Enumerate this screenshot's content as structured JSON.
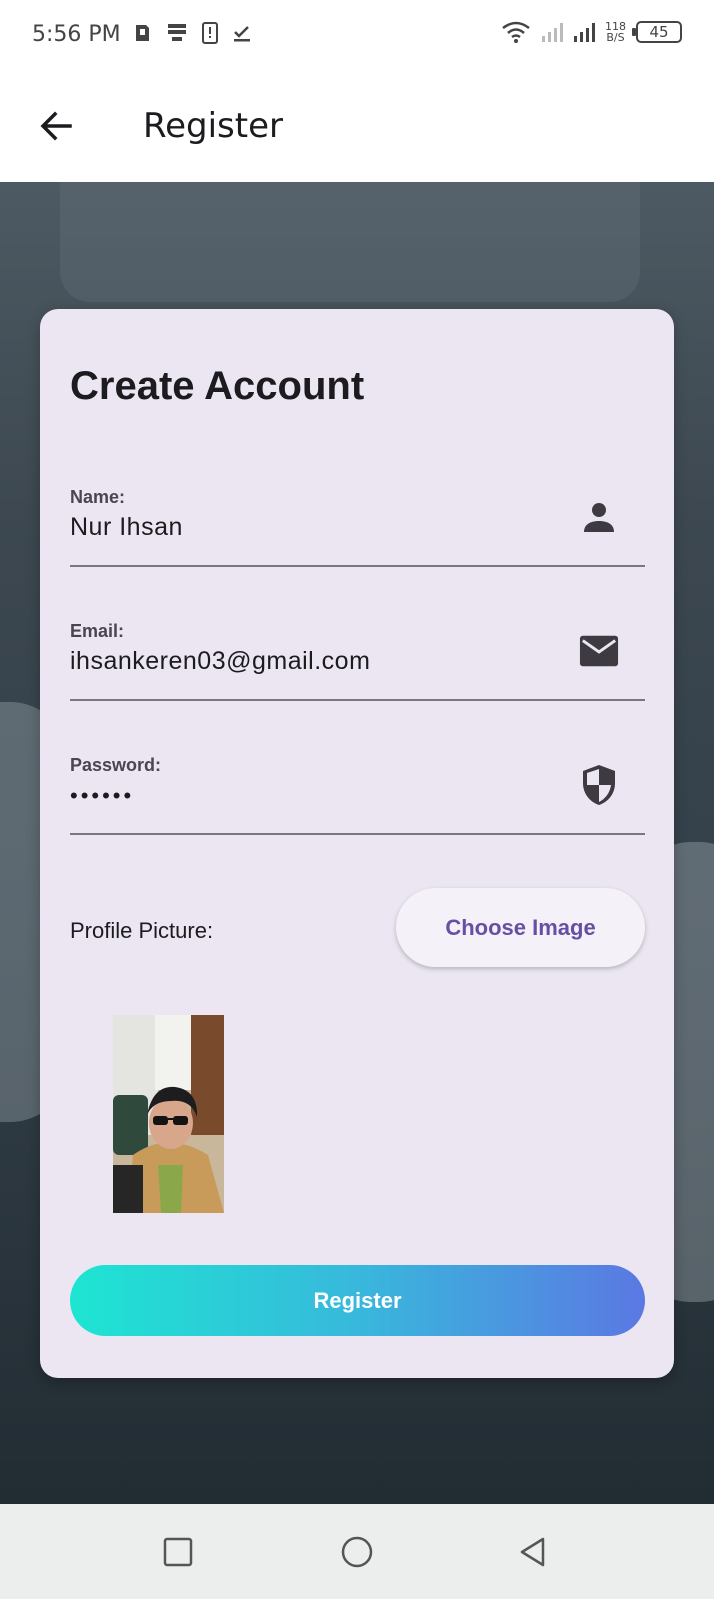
{
  "status_bar": {
    "time": "5:56 PM",
    "net_speed_value": "118",
    "net_speed_unit": "B/S",
    "battery": "45"
  },
  "app_bar": {
    "title": "Register",
    "back_icon": "arrow-left-icon"
  },
  "form": {
    "heading": "Create Account",
    "name_label": "Name:",
    "name_value": "Nur Ihsan",
    "name_icon": "person-icon",
    "email_label": "Email:",
    "email_value": "ihsankeren03@gmail.com",
    "email_icon": "mail-icon",
    "password_label": "Password:",
    "password_value": "••••••",
    "password_icon": "shield-icon",
    "profile_picture_label": "Profile Picture:",
    "choose_image_label": "Choose Image",
    "register_label": "Register"
  },
  "colors": {
    "accent": "#6750a4",
    "card_bg": "#ebe6f1",
    "gradient_start": "#1de5d2",
    "gradient_end": "#5b78e3"
  },
  "nav": {
    "recents_icon": "square-icon",
    "home_icon": "circle-icon",
    "back_icon": "triangle-back-icon"
  }
}
